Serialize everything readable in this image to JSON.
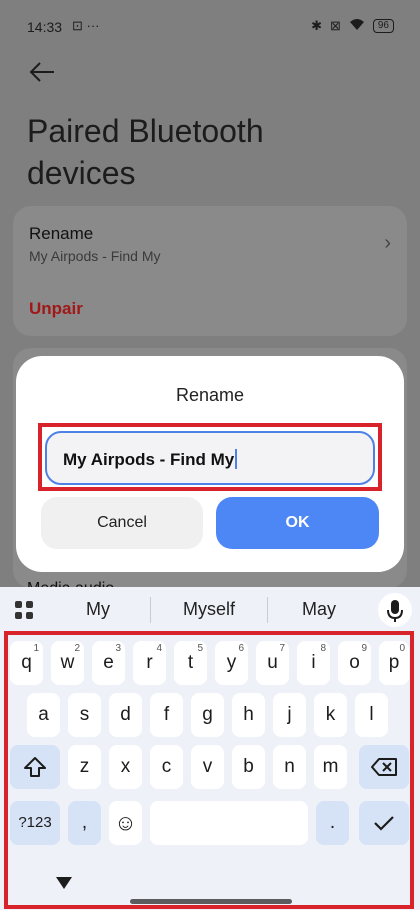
{
  "status": {
    "time": "14:33",
    "left_icons": "⊡ ···",
    "battery": "96"
  },
  "page": {
    "title": "Paired Bluetooth devices"
  },
  "card": {
    "rename_label": "Rename",
    "rename_value": "My Airpods - Find My",
    "unpair_label": "Unpair"
  },
  "media_label": "Media audio",
  "dialog": {
    "title": "Rename",
    "field_value": "My Airpods - Find My",
    "cancel_label": "Cancel",
    "ok_label": "OK"
  },
  "keyboard": {
    "suggestions": [
      "My",
      "Myself",
      "May"
    ],
    "row1": [
      "q",
      "w",
      "e",
      "r",
      "t",
      "y",
      "u",
      "i",
      "o",
      "p"
    ],
    "row1_hints": [
      "1",
      "2",
      "3",
      "4",
      "5",
      "6",
      "7",
      "8",
      "9",
      "0"
    ],
    "row2": [
      "a",
      "s",
      "d",
      "f",
      "g",
      "h",
      "j",
      "k",
      "l"
    ],
    "row3": [
      "z",
      "x",
      "c",
      "v",
      "b",
      "n",
      "m"
    ],
    "symbols_label": "?123",
    "comma": ",",
    "period": ".",
    "emoji": "☺"
  },
  "colors": {
    "accent": "#4d86f5",
    "highlight": "#d8232a",
    "unpair": "#a01818"
  }
}
